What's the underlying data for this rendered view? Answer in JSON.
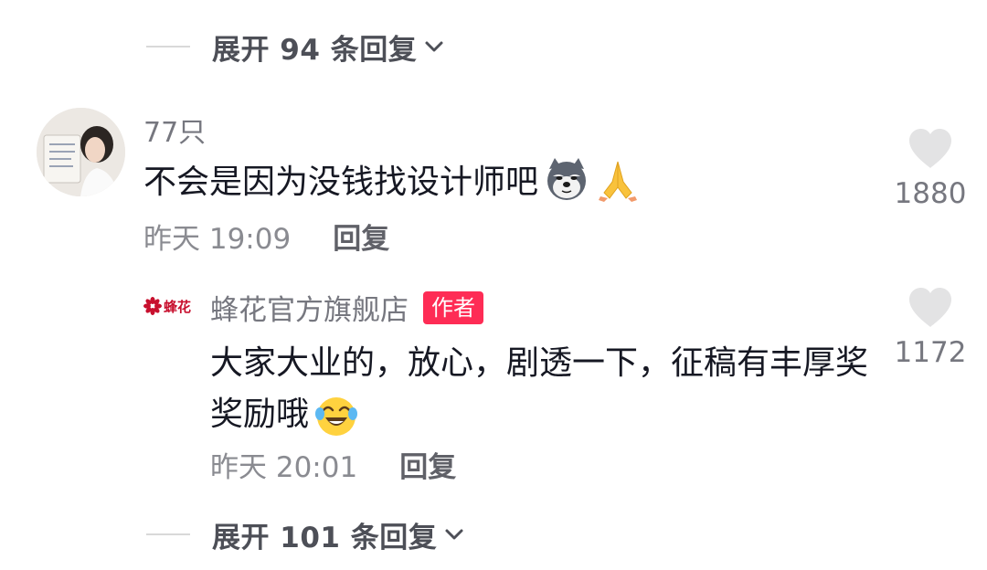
{
  "expand_top": {
    "label": "展开 94 条回复"
  },
  "comment": {
    "username": "77只",
    "text": "不会是因为没钱找设计师吧",
    "time": "昨天 19:09",
    "reply_label": "回复",
    "likes": "1880",
    "emojis": [
      "husky-dog-emoji",
      "praying-hands-emoji"
    ]
  },
  "reply": {
    "brand_logo_text": "蜂花",
    "username": "蜂花官方旗舰店",
    "badge": "作者",
    "text": "大家大业的，放心，剧透一下，征稿有丰厚奖奖励哦",
    "time": "昨天 20:01",
    "reply_label": "回复",
    "likes": "1172",
    "emojis": [
      "tears-of-joy-emoji"
    ]
  },
  "expand_bottom": {
    "label": "展开 101 条回复"
  },
  "colors": {
    "primary_text": "#161823",
    "secondary_text": "#76777f",
    "author_badge": "#fe2c55",
    "heart": "#e3e3e4",
    "brand_red": "#c8102e"
  }
}
